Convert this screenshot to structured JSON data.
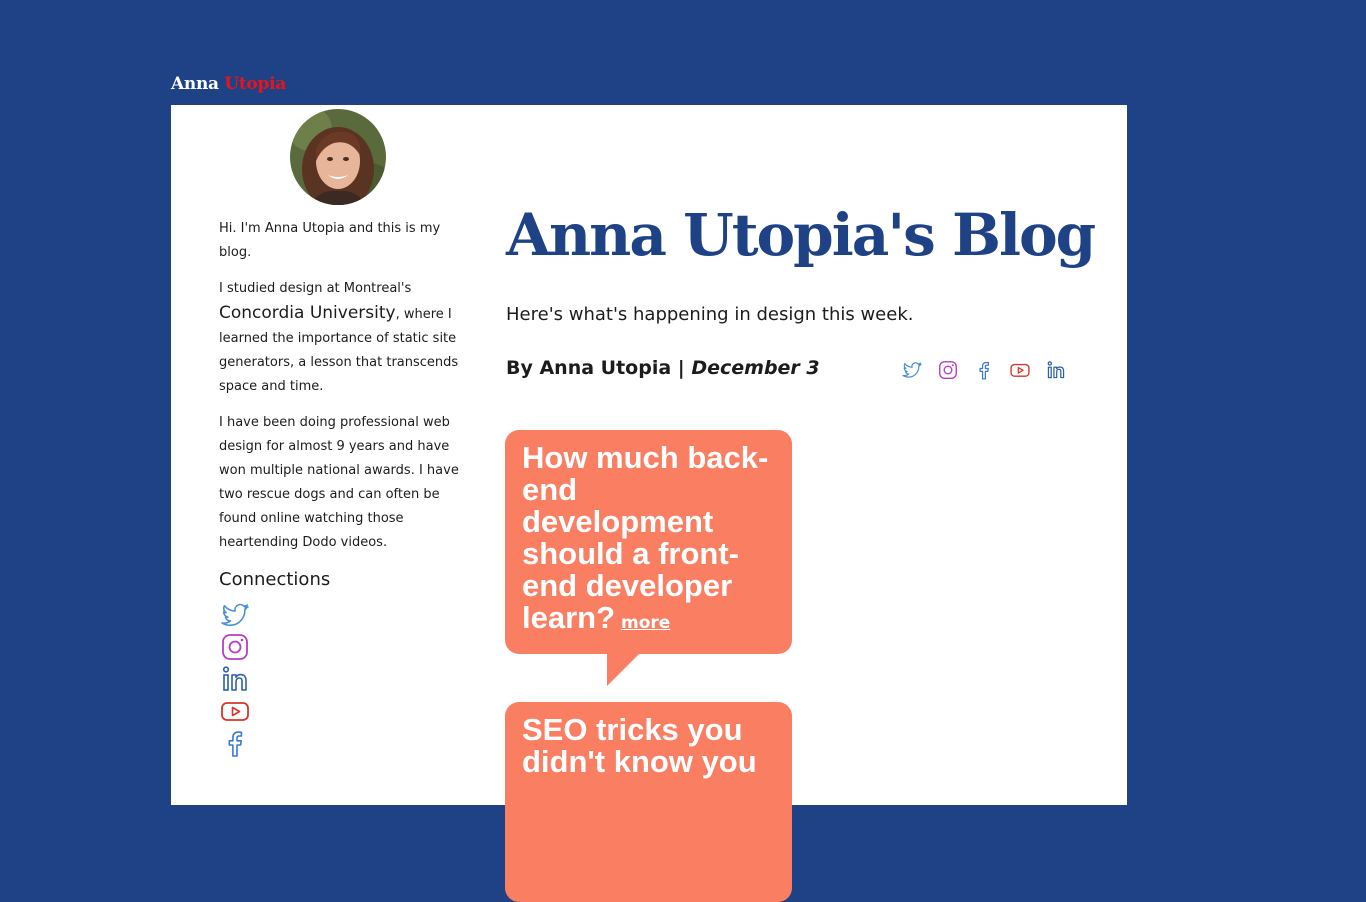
{
  "header": {
    "logo_first": "Anna",
    "logo_second": "Utopia"
  },
  "sidebar": {
    "intro": "Hi. I'm Anna Utopia and this is my blog.",
    "study_before": "I studied design at Montreal's",
    "university": "Concordia University",
    "study_after": ", where I learned the importance of static site generators, a lesson that transcends space and time.",
    "experience": "I have been doing professional web design for almost 9 years and have won multiple national awards. I have two rescue dogs and can often be found online watching those heartending Dodo videos.",
    "connections_title": "Connections",
    "connections": [
      {
        "icon": "twitter-icon",
        "color": "#4a90d9"
      },
      {
        "icon": "instagram-icon",
        "color": "#b83cc4"
      },
      {
        "icon": "linkedin-icon",
        "color": "#2f5fa8"
      },
      {
        "icon": "youtube-icon",
        "color": "#d8342a"
      },
      {
        "icon": "facebook-icon",
        "color": "#3a78d6"
      }
    ]
  },
  "main": {
    "title": "Anna Utopia's Blog",
    "subtitle": "Here's what's happening in design this week.",
    "byline_author": "By Anna Utopia | ",
    "byline_date": "December 3",
    "share_icons": [
      "twitter-icon",
      "instagram-icon",
      "facebook-icon",
      "youtube-icon",
      "linkedin-icon"
    ],
    "posts": [
      {
        "title": "How much back-end development should a front-end developer learn?",
        "more": "more"
      },
      {
        "title": "SEO tricks you didn't know you"
      }
    ]
  },
  "colors": {
    "page_background": "#1e4285",
    "title": "#1e4285",
    "bubble": "#f97e62",
    "logo_accent": "#e8141c"
  }
}
